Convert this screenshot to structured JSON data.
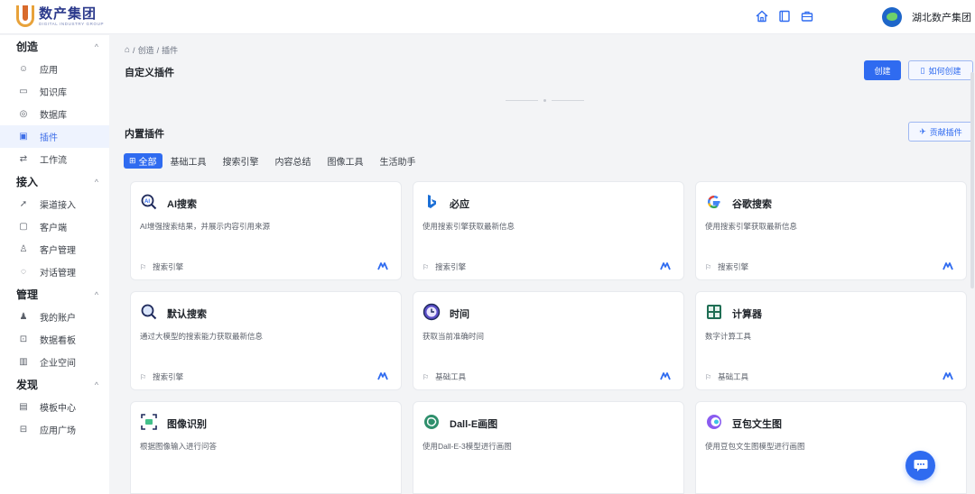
{
  "header": {
    "logo_cn": "数产集团",
    "logo_en": "DIGITAL INDUSTRY GROUP",
    "user_name": "湖北数产集团",
    "icons": [
      "home-icon",
      "book-icon",
      "briefcase-icon"
    ]
  },
  "sidebar": {
    "groups": [
      {
        "title": "创造",
        "items": [
          {
            "label": "应用",
            "icon": "robot-icon"
          },
          {
            "label": "知识库",
            "icon": "book-icon"
          },
          {
            "label": "数据库",
            "icon": "database-icon"
          },
          {
            "label": "插件",
            "icon": "plugin-icon",
            "active": true
          },
          {
            "label": "工作流",
            "icon": "workflow-icon"
          }
        ]
      },
      {
        "title": "接入",
        "items": [
          {
            "label": "渠道接入",
            "icon": "rocket-icon"
          },
          {
            "label": "客户端",
            "icon": "monitor-icon"
          },
          {
            "label": "客户管理",
            "icon": "users-icon"
          },
          {
            "label": "对话管理",
            "icon": "chat-icon"
          }
        ]
      },
      {
        "title": "管理",
        "items": [
          {
            "label": "我的账户",
            "icon": "user-icon"
          },
          {
            "label": "数据看板",
            "icon": "dashboard-icon"
          },
          {
            "label": "企业空间",
            "icon": "building-icon"
          }
        ]
      },
      {
        "title": "发现",
        "items": [
          {
            "label": "模板中心",
            "icon": "template-icon"
          },
          {
            "label": "应用广场",
            "icon": "grid-icon"
          }
        ]
      }
    ]
  },
  "breadcrumb": {
    "level1": "创造",
    "sep": "/",
    "level2": "插件"
  },
  "custom": {
    "title": "自定义插件",
    "create_label": "创建",
    "howto_label": "如何创建"
  },
  "builtin": {
    "title": "内置插件",
    "contribute_label": "贡献插件",
    "tabs": [
      "全部",
      "基础工具",
      "搜索引擎",
      "内容总结",
      "图像工具",
      "生活助手"
    ],
    "cards": [
      {
        "title": "AI搜索",
        "desc": "AI增强搜索结果，并展示内容引用来源",
        "tag": "搜索引擎",
        "icon": "ai-search-icon"
      },
      {
        "title": "必应",
        "desc": "使用搜索引擎获取最新信息",
        "tag": "搜索引擎",
        "icon": "bing-icon"
      },
      {
        "title": "谷歌搜索",
        "desc": "使用搜索引擎获取最新信息",
        "tag": "搜索引擎",
        "icon": "google-icon"
      },
      {
        "title": "默认搜索",
        "desc": "通过大模型的搜索能力获取最新信息",
        "tag": "搜索引擎",
        "icon": "magnifier-icon"
      },
      {
        "title": "时间",
        "desc": "获取当前准确时间",
        "tag": "基础工具",
        "icon": "clock-icon"
      },
      {
        "title": "计算器",
        "desc": "数字计算工具",
        "tag": "基础工具",
        "icon": "calculator-icon"
      },
      {
        "title": "图像识别",
        "desc": "根据图像输入进行问答",
        "tag": "",
        "icon": "image-scan-icon"
      },
      {
        "title": "Dall-E画图",
        "desc": "使用Dall-E-3模型进行画图",
        "tag": "",
        "icon": "openai-icon"
      },
      {
        "title": "豆包文生图",
        "desc": "使用豆包文生图模型进行画图",
        "tag": "",
        "icon": "doubao-icon"
      }
    ]
  },
  "colors": {
    "primary": "#2f6bf0",
    "active_bg": "#eef3fe"
  }
}
